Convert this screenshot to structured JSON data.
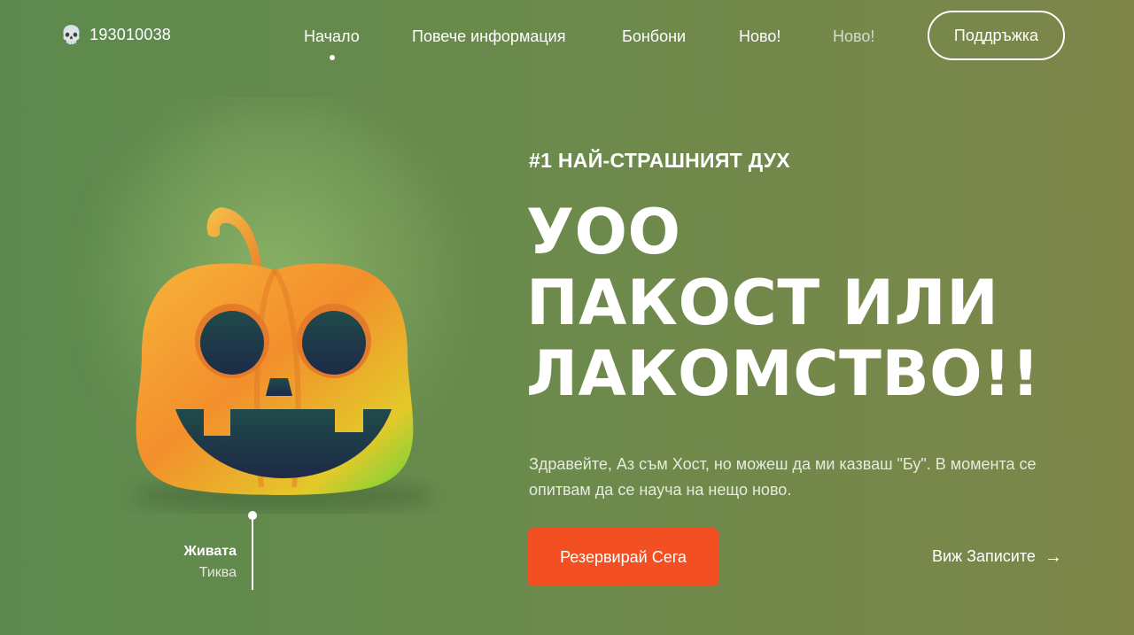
{
  "brand": {
    "number": "193010038",
    "icon": "skull-icon"
  },
  "nav": {
    "items": [
      {
        "label": "Начало"
      },
      {
        "label": "Повече информация"
      },
      {
        "label": "Бонбони"
      },
      {
        "label": "Ново!"
      },
      {
        "label": "Ново!"
      }
    ],
    "support_label": "Поддръжка"
  },
  "hero": {
    "eyebrow": "#1 НАЙ-СТРАШНИЯТ ДУХ",
    "headline": [
      "УОО",
      "ПАКОСТ ИЛИ",
      "ЛАКОМСТВО!!"
    ],
    "description": "Здравейте, Аз съм Хост, но можеш да ми казваш \"Бу\". В момента се опитвам да се науча на нещо ново.",
    "cta_label": "Резервирай Сега",
    "records_label": "Виж Записите",
    "records_icon": "arrow-right-icon"
  },
  "image_caption": {
    "title": "Живата",
    "subtitle": "Тиква"
  },
  "colors": {
    "background_left": "#5c8a4e",
    "background_right": "#7e8649",
    "accent": "#f25022",
    "pumpkin_orange": "#f59a2a"
  }
}
